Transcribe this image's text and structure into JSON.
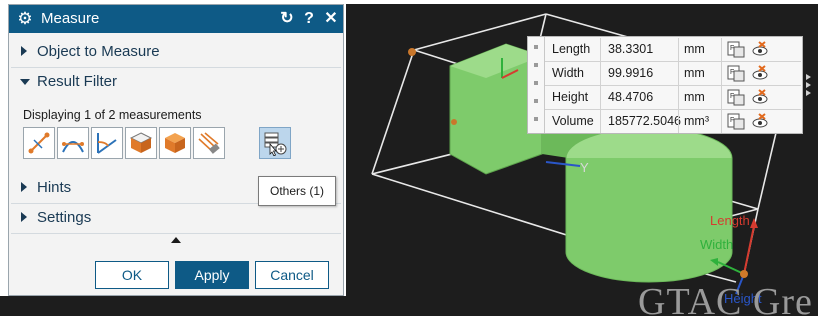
{
  "dialog": {
    "title": "Measure",
    "title_buttons": {
      "reset": "↻",
      "help": "?",
      "close": "✕"
    },
    "sections": {
      "object_to_measure": "Object to Measure",
      "result_filter": "Result Filter",
      "hints": "Hints",
      "settings": "Settings"
    },
    "display_text": "Displaying 1 of 2 measurements",
    "tooltip": "Others (1)",
    "filter_icons": [
      "distance-icon",
      "arc-length-icon",
      "angle-icon",
      "area-icon",
      "volume-icon",
      "pattern-icon",
      "others-icon"
    ],
    "buttons": {
      "ok": "OK",
      "apply": "Apply",
      "cancel": "Cancel"
    }
  },
  "results": [
    {
      "name": "Length",
      "value": "38.3301",
      "unit": "mm"
    },
    {
      "name": "Width",
      "value": "99.9916",
      "unit": "mm"
    },
    {
      "name": "Height",
      "value": "48.4706",
      "unit": "mm"
    },
    {
      "name": "Volume",
      "value": "185772.5046",
      "unit": "mm³"
    }
  ],
  "scene": {
    "axis_labels": {
      "y": "Y",
      "length": "Length",
      "width": "Width",
      "height": "Height"
    },
    "watermark": "GTAC Gre"
  },
  "colors": {
    "title_bar": "#0e5a86",
    "viewport_background": "#1d1d1d",
    "part_green": "#7ecb6b",
    "length_axis": "#d63b2f",
    "width_axis": "#2fb13c",
    "height_axis": "#2a56c8"
  }
}
